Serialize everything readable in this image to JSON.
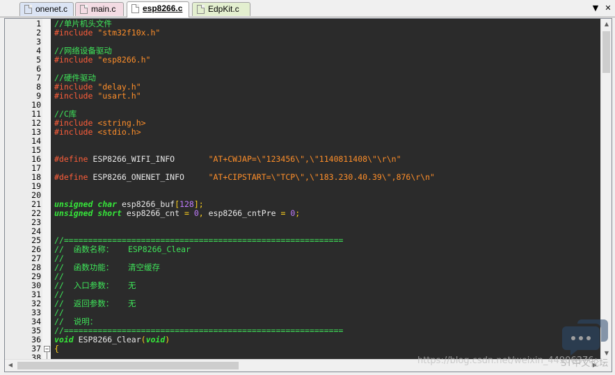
{
  "tabs": [
    {
      "label": "onenet.c",
      "color": "#dbe4f4",
      "active": false
    },
    {
      "label": "main.c",
      "color": "#f3dbe3",
      "active": false
    },
    {
      "label": "esp8266.c",
      "color": "#ffffff",
      "active": true
    },
    {
      "label": "EdpKit.c",
      "color": "#e3efcf",
      "active": false
    }
  ],
  "tab_controls": {
    "list_icon": "chevron-down-icon",
    "close_icon": "close-icon",
    "list_glyph": "▼",
    "close_glyph": "✕"
  },
  "editor": {
    "lines": [
      {
        "n": "1",
        "seg": [
          [
            "c-comment",
            "//单片机头文件"
          ]
        ]
      },
      {
        "n": "2",
        "seg": [
          [
            "c-pre",
            "#include "
          ],
          [
            "c-str",
            "\"stm32f10x.h\""
          ]
        ]
      },
      {
        "n": "3",
        "seg": []
      },
      {
        "n": "4",
        "seg": [
          [
            "c-comment",
            "//网络设备驱动"
          ]
        ]
      },
      {
        "n": "5",
        "seg": [
          [
            "c-pre",
            "#include "
          ],
          [
            "c-str",
            "\"esp8266.h\""
          ]
        ]
      },
      {
        "n": "6",
        "seg": []
      },
      {
        "n": "7",
        "seg": [
          [
            "c-comment",
            "//硬件驱动"
          ]
        ]
      },
      {
        "n": "8",
        "seg": [
          [
            "c-pre",
            "#include "
          ],
          [
            "c-str",
            "\"delay.h\""
          ]
        ]
      },
      {
        "n": "9",
        "seg": [
          [
            "c-pre",
            "#include "
          ],
          [
            "c-str",
            "\"usart.h\""
          ]
        ]
      },
      {
        "n": "10",
        "seg": []
      },
      {
        "n": "11",
        "seg": [
          [
            "c-comment",
            "//C库"
          ]
        ]
      },
      {
        "n": "12",
        "seg": [
          [
            "c-pre",
            "#include "
          ],
          [
            "c-str",
            "<string.h>"
          ]
        ]
      },
      {
        "n": "13",
        "seg": [
          [
            "c-pre",
            "#include "
          ],
          [
            "c-str",
            "<stdio.h>"
          ]
        ]
      },
      {
        "n": "14",
        "seg": []
      },
      {
        "n": "15",
        "seg": []
      },
      {
        "n": "16",
        "seg": [
          [
            "c-pre",
            "#define "
          ],
          [
            "c-plain",
            "ESP8266_WIFI_INFO       "
          ],
          [
            "c-str",
            "\"AT+CWJAP=\\\"123456\\\",\\\"1140811408\\\"\\r\\n\""
          ]
        ]
      },
      {
        "n": "17",
        "seg": []
      },
      {
        "n": "18",
        "seg": [
          [
            "c-pre",
            "#define "
          ],
          [
            "c-plain",
            "ESP8266_ONENET_INFO     "
          ],
          [
            "c-str",
            "\"AT+CIPSTART=\\\"TCP\\\",\\\"183.230.40.39\\\",876\\r\\n\""
          ]
        ]
      },
      {
        "n": "19",
        "seg": []
      },
      {
        "n": "20",
        "seg": []
      },
      {
        "n": "21",
        "seg": [
          [
            "c-kw",
            "unsigned char"
          ],
          [
            "c-plain",
            " esp8266_buf"
          ],
          [
            "c-op",
            "["
          ],
          [
            "c-num",
            "128"
          ],
          [
            "c-op",
            "];"
          ]
        ]
      },
      {
        "n": "22",
        "seg": [
          [
            "c-kw",
            "unsigned short"
          ],
          [
            "c-plain",
            " esp8266_cnt "
          ],
          [
            "c-op",
            "="
          ],
          [
            "c-plain",
            " "
          ],
          [
            "c-num",
            "0"
          ],
          [
            "c-op",
            ","
          ],
          [
            "c-plain",
            " esp8266_cntPre "
          ],
          [
            "c-op",
            "="
          ],
          [
            "c-plain",
            " "
          ],
          [
            "c-num",
            "0"
          ],
          [
            "c-op",
            ";"
          ]
        ]
      },
      {
        "n": "23",
        "seg": []
      },
      {
        "n": "24",
        "seg": []
      },
      {
        "n": "25",
        "seg": [
          [
            "c-comment",
            "//=========================================================="
          ]
        ]
      },
      {
        "n": "26",
        "seg": [
          [
            "c-comment",
            "//  函数名称：   ESP8266_Clear"
          ]
        ]
      },
      {
        "n": "27",
        "seg": [
          [
            "c-comment",
            "//"
          ]
        ]
      },
      {
        "n": "28",
        "seg": [
          [
            "c-comment",
            "//  函数功能：   清空缓存"
          ]
        ]
      },
      {
        "n": "29",
        "seg": [
          [
            "c-comment",
            "//"
          ]
        ]
      },
      {
        "n": "30",
        "seg": [
          [
            "c-comment",
            "//  入口参数：   无"
          ]
        ]
      },
      {
        "n": "31",
        "seg": [
          [
            "c-comment",
            "//"
          ]
        ]
      },
      {
        "n": "32",
        "seg": [
          [
            "c-comment",
            "//  返回参数：   无"
          ]
        ]
      },
      {
        "n": "33",
        "seg": [
          [
            "c-comment",
            "//"
          ]
        ]
      },
      {
        "n": "34",
        "seg": [
          [
            "c-comment",
            "//  说明："
          ]
        ]
      },
      {
        "n": "35",
        "seg": [
          [
            "c-comment",
            "//=========================================================="
          ]
        ]
      },
      {
        "n": "36",
        "seg": [
          [
            "c-kw",
            "void"
          ],
          [
            "c-plain",
            " ESP8266_Clear"
          ],
          [
            "c-op",
            "("
          ],
          [
            "c-kw",
            "void"
          ],
          [
            "c-op",
            ")"
          ]
        ]
      },
      {
        "n": "37",
        "seg": [
          [
            "c-op",
            "{"
          ]
        ]
      },
      {
        "n": "38",
        "seg": []
      }
    ],
    "fold_line": "37",
    "fold_glyph": "−"
  },
  "scrollbars": {
    "up_glyph": "▲",
    "down_glyph": "▼",
    "left_glyph": "◀",
    "right_glyph": "▶"
  },
  "watermark": {
    "text": "https://blog.csdn.net/weixin_44906376",
    "suffix": "ST中文论坛"
  }
}
